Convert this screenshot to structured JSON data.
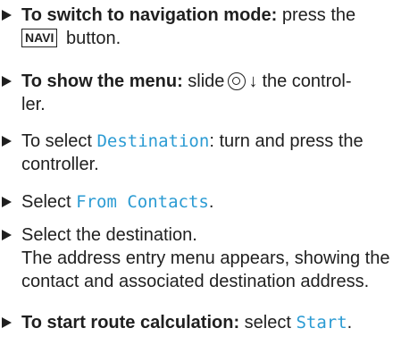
{
  "steps": [
    {
      "bold": "To switch to navigation mode:",
      "after_bold": " press the",
      "key": "NAVI",
      "after_key": " button."
    },
    {
      "bold": "To show the menu:",
      "after_bold": " slide",
      "arrow": "↓",
      "after_knob": "the control-",
      "line2": "ler."
    },
    {
      "prefix": "To select ",
      "item": "Destination",
      "suffix": ": turn and press the",
      "line2": "controller."
    },
    {
      "prefix": "Select ",
      "item": "From Contacts",
      "suffix": "."
    },
    {
      "text": "Select the destination.",
      "note": "The address entry menu appears, showing the contact and associated destination address."
    },
    {
      "bold": "To start route calculation:",
      "after_bold": " select ",
      "item": "Start",
      "suffix": "."
    }
  ],
  "colors": {
    "accent": "#2b9bd3",
    "text": "#1f1f1f"
  },
  "icons": [
    "triangle-bullet-icon",
    "controller-knob-icon",
    "slide-down-arrow-icon"
  ]
}
